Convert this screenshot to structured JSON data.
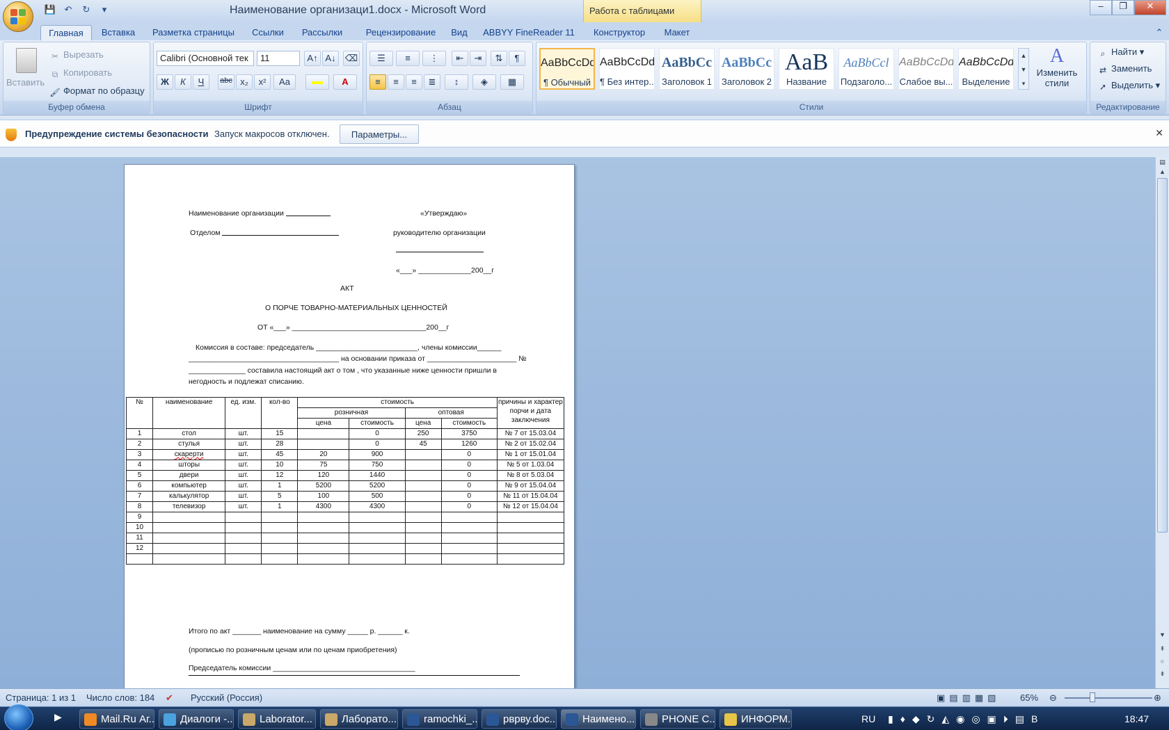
{
  "window": {
    "title": "Наименование организаци1.docx - Microsoft Word",
    "context_tab": "Работа с таблицами",
    "min": "–",
    "max": "❐",
    "close": "✕"
  },
  "qat": {
    "save": "💾",
    "undo": "↶",
    "redo": "↻",
    "more": "▾"
  },
  "tabs": [
    "Главная",
    "Вставка",
    "Разметка страницы",
    "Ссылки",
    "Рассылки",
    "Рецензирование",
    "Вид",
    "ABBYY FineReader 11",
    "Конструктор",
    "Макет"
  ],
  "clipboard": {
    "paste": "Вставить",
    "cut": "Вырезать",
    "copy": "Копировать",
    "format_painter": "Формат по образцу",
    "label": "Буфер обмена"
  },
  "font": {
    "name": "Calibri (Основной тек",
    "size": "11",
    "label": "Шрифт",
    "bold": "Ж",
    "italic": "К",
    "underline": "Ч",
    "strike": "abc",
    "sub": "x₂",
    "sup": "x²",
    "case": "Aa"
  },
  "paragraph": {
    "label": "Абзац"
  },
  "styles": {
    "label": "Стили",
    "items": [
      {
        "preview": "AaBbCcDd",
        "name": "¶ Обычный"
      },
      {
        "preview": "AaBbCcDd",
        "name": "¶ Без интер..."
      },
      {
        "preview": "AaBbCc",
        "name": "Заголовок 1"
      },
      {
        "preview": "AaBbCc",
        "name": "Заголовок 2"
      },
      {
        "preview": "AaB",
        "name": "Название"
      },
      {
        "preview": "AaBbCcl",
        "name": "Подзаголо..."
      },
      {
        "preview": "AaBbCcDd",
        "name": "Слабое вы..."
      },
      {
        "preview": "AaBbCcDd",
        "name": "Выделение"
      }
    ],
    "change_styles": "Изменить стили"
  },
  "editing": {
    "label": "Редактирование",
    "find": "Найти",
    "replace": "Заменить",
    "select": "Выделить"
  },
  "security": {
    "title": "Предупреждение системы безопасности",
    "text": "Запуск макросов отключен.",
    "button": "Параметры..."
  },
  "document": {
    "org_line": "Наименование организации",
    "approve": "«Утверждаю»",
    "dept": "Отделом",
    "head": "руководителю организации",
    "date_line": "«___» _____________200__г",
    "act": "АКТ",
    "subtitle": "О ПОРЧЕ ТОВАРНО-МАТЕРИАЛЬНЫХ ЦЕННОСТЕЙ",
    "from_line": "ОТ «___» _________________________________200__г",
    "para1": "Комиссия в составе: председатель _________________________, члены комиссии______",
    "para2": "_____________________________________ на основании приказа от ______________________ №",
    "para3": "______________ составила настоящий акт о том , что указанные ниже ценности пришли в",
    "para4": "негодность и подлежат списанию.",
    "table_headers": {
      "num": "№",
      "name": "наименование",
      "unit": "ед. изм.",
      "qty": "кол-во",
      "cost": "стоимость",
      "retail": "розничная",
      "wholesale": "оптовая",
      "price": "цена",
      "amount": "стоимость",
      "reason": "причины и характер порчи и дата заключения"
    },
    "rows": [
      {
        "n": "1",
        "name": "стол",
        "unit": "шт.",
        "qty": "15",
        "rp": "",
        "ra": "0",
        "wp": "250",
        "wa": "3750",
        "reason": "№ 7 от 15.03.04"
      },
      {
        "n": "2",
        "name": "стулья",
        "unit": "шт.",
        "qty": "28",
        "rp": "",
        "ra": "0",
        "wp": "45",
        "wa": "1260",
        "reason": "№ 2 от 15.02.04"
      },
      {
        "n": "3",
        "name": "скарерти",
        "unit": "шт.",
        "qty": "45",
        "rp": "20",
        "ra": "900",
        "wp": "",
        "wa": "0",
        "reason": "№ 1 от 15.01.04"
      },
      {
        "n": "4",
        "name": "шторы",
        "unit": "шт.",
        "qty": "10",
        "rp": "75",
        "ra": "750",
        "wp": "",
        "wa": "0",
        "reason": "№ 5 от 1.03.04"
      },
      {
        "n": "5",
        "name": "двери",
        "unit": "шт.",
        "qty": "12",
        "rp": "120",
        "ra": "1440",
        "wp": "",
        "wa": "0",
        "reason": "№ 8 от 5.03.04"
      },
      {
        "n": "6",
        "name": "компьютер",
        "unit": "шт.",
        "qty": "1",
        "rp": "5200",
        "ra": "5200",
        "wp": "",
        "wa": "0",
        "reason": "№ 9 от 15.04.04"
      },
      {
        "n": "7",
        "name": "калькулятор",
        "unit": "шт.",
        "qty": "5",
        "rp": "100",
        "ra": "500",
        "wp": "",
        "wa": "0",
        "reason": "№ 11 от 15.04.04"
      },
      {
        "n": "8",
        "name": "телевизор",
        "unit": "шт.",
        "qty": "1",
        "rp": "4300",
        "ra": "4300",
        "wp": "",
        "wa": "0",
        "reason": "№ 12 от 15.04.04"
      },
      {
        "n": "9",
        "name": "",
        "unit": "",
        "qty": "",
        "rp": "",
        "ra": "",
        "wp": "",
        "wa": "",
        "reason": ""
      },
      {
        "n": "10",
        "name": "",
        "unit": "",
        "qty": "",
        "rp": "",
        "ra": "",
        "wp": "",
        "wa": "",
        "reason": ""
      },
      {
        "n": "11",
        "name": "",
        "unit": "",
        "qty": "",
        "rp": "",
        "ra": "",
        "wp": "",
        "wa": "",
        "reason": ""
      },
      {
        "n": "12",
        "name": "",
        "unit": "",
        "qty": "",
        "rp": "",
        "ra": "",
        "wp": "",
        "wa": "",
        "reason": ""
      },
      {
        "n": "",
        "name": "",
        "unit": "",
        "qty": "",
        "rp": "",
        "ra": "",
        "wp": "",
        "wa": "",
        "reason": ""
      }
    ],
    "total": "Итого по акт _______ наименование на сумму _____ р. ______ к.",
    "note": "(прописью по розничным ценам или по ценам приобретения)",
    "chair": "Председатель комиссии ___________________________________"
  },
  "status": {
    "page": "Страница: 1 из 1",
    "words": "Число слов: 184",
    "lang": "Русский (Россия)",
    "zoom": "65%"
  },
  "taskbar": {
    "items": [
      {
        "label": "Mail.Ru Аг...",
        "color": "#f08a24"
      },
      {
        "label": "Диалоги -...",
        "color": "#4aa3df"
      },
      {
        "label": "Laborator...",
        "color": "#c9a86a"
      },
      {
        "label": "Лаборато...",
        "color": "#c9a86a"
      },
      {
        "label": "ramochki_...",
        "color": "#2b5797"
      },
      {
        "label": "рврву.doc...",
        "color": "#2b5797"
      },
      {
        "label": "Наимено...",
        "color": "#2b5797"
      },
      {
        "label": "PHONE C...",
        "color": "#888888"
      },
      {
        "label": "ИНФОРМ...",
        "color": "#e8c547"
      }
    ],
    "lang": "RU",
    "time": "18:47"
  }
}
